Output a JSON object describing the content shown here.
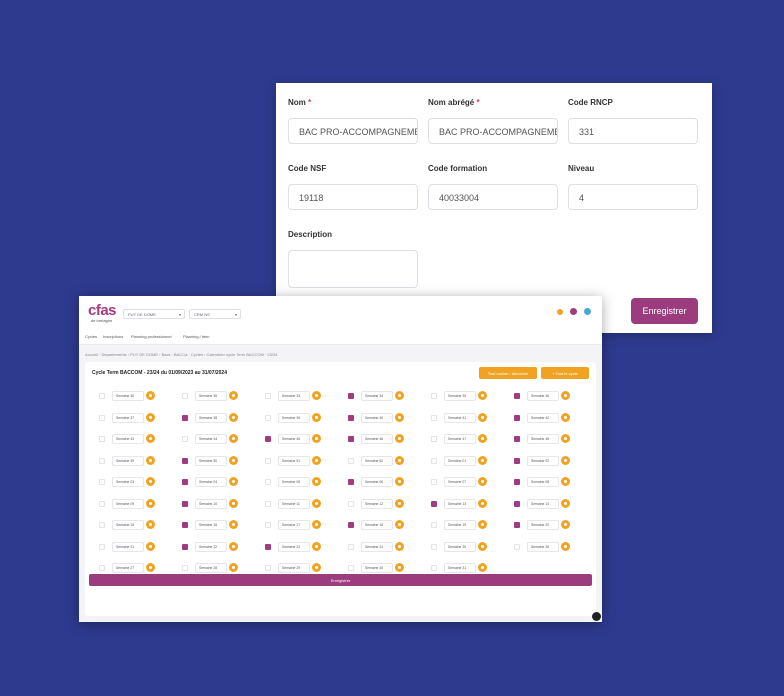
{
  "form": {
    "nom_label": "Nom",
    "nom_value": "BAC PRO-ACCOMPAGNEMEI",
    "nom_abrege_label": "Nom abrégé",
    "nom_abrege_value": "BAC PRO-ACCOMPAGNEMEI",
    "code_rncp_label": "Code RNCP",
    "code_rncp_value": "331",
    "code_nsf_label": "Code NSF",
    "code_nsf_value": "19118",
    "code_formation_label": "Code formation",
    "code_formation_value": "40033004",
    "niveau_label": "Niveau",
    "niveau_value": "4",
    "description_label": "Description",
    "description_value": "",
    "required_mark": "*",
    "save_label": "Enregistrer"
  },
  "app": {
    "logo": "cfas",
    "logo_sub": "de bretagne",
    "select1": "PUY DE DOME",
    "select2": "CRM NS",
    "nav": [
      "Cycles",
      "Inscriptions",
      "Planning professionnel",
      "Planning / item"
    ],
    "breadcrumb": "Accueil · Départements › PUY DE DOME › Bacs · BACCa · Cycles › Calendrier cycle Term BACCOM · 23/24",
    "cycle_title": "Cycle Term BACCOM - 23/24 du 01/09/2023 au 31/07/2024",
    "btn_toggle": "Tout cocher / décocher",
    "btn_all": "+ Tout le cycle",
    "save_label": "Enregistrer",
    "accent_color": "#a13c83",
    "orange_color": "#f0a323"
  },
  "weeks": [
    {
      "label": "Semaine 35",
      "checked": false
    },
    {
      "label": "Semaine 36",
      "checked": false
    },
    {
      "label": "Semaine 33",
      "checked": false
    },
    {
      "label": "Semaine 34",
      "checked": true
    },
    {
      "label": "Semaine 35",
      "checked": false
    },
    {
      "label": "Semaine 36",
      "checked": true
    },
    {
      "label": "Semaine 37",
      "checked": false
    },
    {
      "label": "Semaine 38",
      "checked": true
    },
    {
      "label": "Semaine 39",
      "checked": false
    },
    {
      "label": "Semaine 40",
      "checked": true
    },
    {
      "label": "Semaine 41",
      "checked": false
    },
    {
      "label": "Semaine 42",
      "checked": true
    },
    {
      "label": "Semaine 43",
      "checked": false
    },
    {
      "label": "Semaine 44",
      "checked": false
    },
    {
      "label": "Semaine 45",
      "checked": true
    },
    {
      "label": "Semaine 46",
      "checked": true
    },
    {
      "label": "Semaine 47",
      "checked": false
    },
    {
      "label": "Semaine 48",
      "checked": true
    },
    {
      "label": "Semaine 49",
      "checked": false
    },
    {
      "label": "Semaine 50",
      "checked": true
    },
    {
      "label": "Semaine 51",
      "checked": false
    },
    {
      "label": "Semaine 52",
      "checked": false
    },
    {
      "label": "Semaine 01",
      "checked": false
    },
    {
      "label": "Semaine 02",
      "checked": true
    },
    {
      "label": "Semaine 03",
      "checked": false
    },
    {
      "label": "Semaine 04",
      "checked": true
    },
    {
      "label": "Semaine 05",
      "checked": false
    },
    {
      "label": "Semaine 06",
      "checked": true
    },
    {
      "label": "Semaine 07",
      "checked": false
    },
    {
      "label": "Semaine 08",
      "checked": true
    },
    {
      "label": "Semaine 09",
      "checked": false
    },
    {
      "label": "Semaine 10",
      "checked": true
    },
    {
      "label": "Semaine 11",
      "checked": false
    },
    {
      "label": "Semaine 12",
      "checked": false
    },
    {
      "label": "Semaine 13",
      "checked": true
    },
    {
      "label": "Semaine 14",
      "checked": true
    },
    {
      "label": "Semaine 15",
      "checked": false
    },
    {
      "label": "Semaine 16",
      "checked": true
    },
    {
      "label": "Semaine 17",
      "checked": false
    },
    {
      "label": "Semaine 18",
      "checked": true
    },
    {
      "label": "Semaine 19",
      "checked": false
    },
    {
      "label": "Semaine 20",
      "checked": true
    },
    {
      "label": "Semaine 21",
      "checked": false
    },
    {
      "label": "Semaine 22",
      "checked": true
    },
    {
      "label": "Semaine 23",
      "checked": true
    },
    {
      "label": "Semaine 24",
      "checked": false
    },
    {
      "label": "Semaine 25",
      "checked": false
    },
    {
      "label": "Semaine 26",
      "checked": false
    },
    {
      "label": "Semaine 27",
      "checked": false
    },
    {
      "label": "Semaine 28",
      "checked": false
    },
    {
      "label": "Semaine 29",
      "checked": false
    },
    {
      "label": "Semaine 30",
      "checked": false
    },
    {
      "label": "Semaine 31",
      "checked": false
    }
  ]
}
